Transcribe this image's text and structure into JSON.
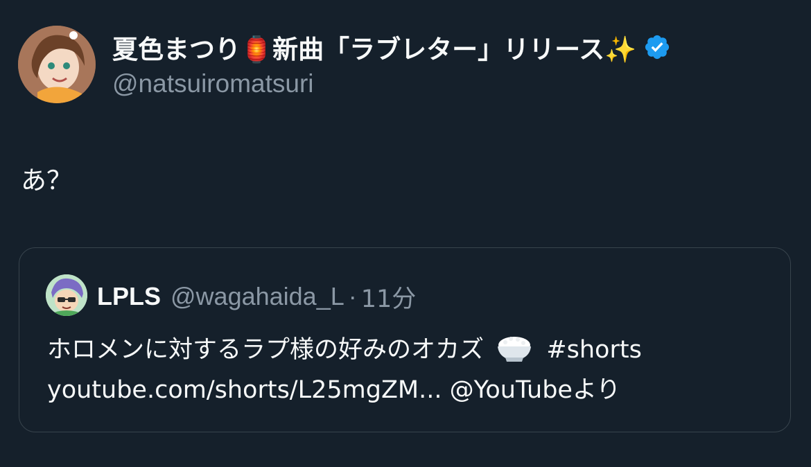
{
  "tweet": {
    "author": {
      "display_name": "夏色まつり🏮新曲「ラブレター」リリース✨",
      "handle": "@natsuiromatsuri",
      "verified": true,
      "verified_color": "#1d9bf0"
    },
    "text": "あ？"
  },
  "quoted_tweet": {
    "author": {
      "display_name": "LPLS",
      "handle": "@wagahaida_L",
      "time_separator": "·",
      "time": "11分"
    },
    "line1_text": "ホロメンに対するラプ様の好みのオカズ",
    "line1_emoji": "rice-bowl-icon",
    "line1_hashtag": "#shorts",
    "line2_text": "youtube.com/shorts/L25mgZM... @YouTubeより"
  },
  "colors": {
    "background": "#15202b",
    "primary_text": "#f7f9f9",
    "secondary_text": "#8b98a5",
    "border": "#38444d"
  }
}
